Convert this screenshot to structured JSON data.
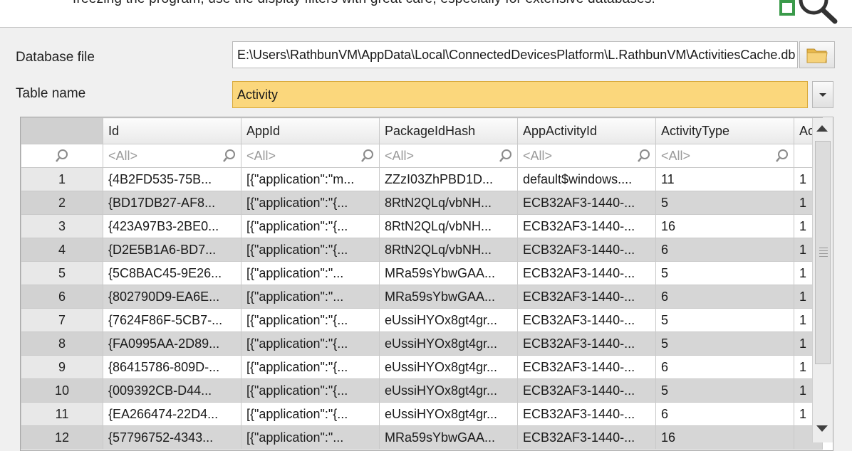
{
  "banner": {
    "text": "freezing the program, use the display filters with great care, especially for extensive databases!",
    "icon": "search-magnifier-icon"
  },
  "form": {
    "db_label": "Database file",
    "db_value": "E:\\Users\\RathbunVM\\AppData\\Local\\ConnectedDevicesPlatform\\L.RathbunVM\\ActivitiesCache.db",
    "table_label": "Table name",
    "table_value": "Activity"
  },
  "grid": {
    "columns": [
      "Id",
      "AppId",
      "PackageIdHash",
      "AppActivityId",
      "ActivityType",
      "Ac"
    ],
    "filter_placeholder": "<All>",
    "rows": [
      {
        "num": "1",
        "cells": [
          "{4B2FD535-75B...",
          "[{\"application\":\"m...",
          "ZZzI03ZhPBD1D...",
          "default$windows....",
          "11",
          "1"
        ]
      },
      {
        "num": "2",
        "cells": [
          "{BD17DB27-AF8...",
          "[{\"application\":\"{...",
          "8RtN2QLq/vbNH...",
          "ECB32AF3-1440-...",
          "5",
          "1"
        ]
      },
      {
        "num": "3",
        "cells": [
          "{423A97B3-2BE0...",
          "[{\"application\":\"{...",
          "8RtN2QLq/vbNH...",
          "ECB32AF3-1440-...",
          "16",
          "1"
        ]
      },
      {
        "num": "4",
        "cells": [
          "{D2E5B1A6-BD7...",
          "[{\"application\":\"{...",
          "8RtN2QLq/vbNH...",
          "ECB32AF3-1440-...",
          "6",
          "1"
        ]
      },
      {
        "num": "5",
        "cells": [
          "{5C8BAC45-9E26...",
          "[{\"application\":\"...",
          "MRa59sYbwGAA...",
          "ECB32AF3-1440-...",
          "5",
          "1"
        ]
      },
      {
        "num": "6",
        "cells": [
          "{802790D9-EA6E...",
          "[{\"application\":\"...",
          "MRa59sYbwGAA...",
          "ECB32AF3-1440-...",
          "6",
          "1"
        ]
      },
      {
        "num": "7",
        "cells": [
          "{7624F86F-5CB7-...",
          "[{\"application\":\"{...",
          "eUssiHYOx8gt4gr...",
          "ECB32AF3-1440-...",
          "5",
          "1"
        ]
      },
      {
        "num": "8",
        "cells": [
          "{FA0995AA-2D89...",
          "[{\"application\":\"{...",
          "eUssiHYOx8gt4gr...",
          "ECB32AF3-1440-...",
          "5",
          "1"
        ]
      },
      {
        "num": "9",
        "cells": [
          "{86415786-809D-...",
          "[{\"application\":\"{...",
          "eUssiHYOx8gt4gr...",
          "ECB32AF3-1440-...",
          "6",
          "1"
        ]
      },
      {
        "num": "10",
        "cells": [
          "{009392CB-D44...",
          "[{\"application\":\"{...",
          "eUssiHYOx8gt4gr...",
          "ECB32AF3-1440-...",
          "5",
          "1"
        ]
      },
      {
        "num": "11",
        "cells": [
          "{EA266474-22D4...",
          "[{\"application\":\"{...",
          "eUssiHYOx8gt4gr...",
          "ECB32AF3-1440-...",
          "6",
          "1"
        ]
      },
      {
        "num": "12",
        "cells": [
          "{57796752-4343...",
          "[{\"application\":\"...",
          "MRa59sYbwGAA...",
          "ECB32AF3-1440-...",
          "16",
          ""
        ]
      }
    ]
  },
  "colors": {
    "selected_field": "#fbd77c",
    "alt_row": "#d6d6d6"
  }
}
